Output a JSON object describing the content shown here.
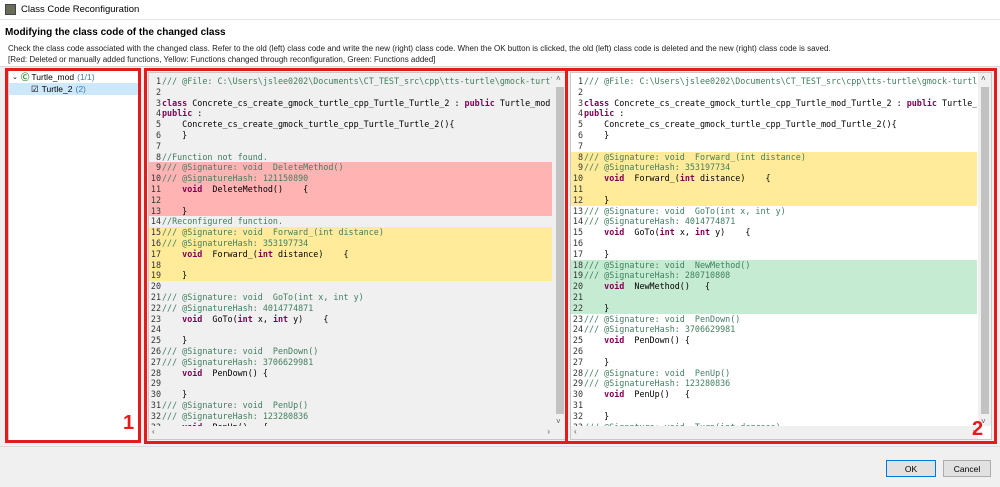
{
  "window": {
    "title": "Class Code Reconfiguration"
  },
  "header": {
    "heading": "Modifying the class code of the changed class",
    "description": "Check the class code associated with the changed class. Refer to the old (left) class code and write the new (right) class code. When the OK button is clicked, the old (left) class code is deleted and the new (right) class code is saved.",
    "legend": "[Red: Deleted or manually added functions, Yellow: Functions changed through reconfiguration, Green: Functions added]"
  },
  "tree": {
    "root": {
      "label": "Turtle_mod",
      "count": "(1/1)"
    },
    "child": {
      "label": "Turtle_2",
      "count": "(2)"
    }
  },
  "annotations": {
    "one": "1",
    "two": "2"
  },
  "colors": {
    "red": "#ffb3b3",
    "yellow": "#ffeb99",
    "green": "#c5ebd2",
    "annotation": "#e51a1a"
  },
  "left_code": [
    {
      "n": "1",
      "t": "/// @File: C:\\Users\\jslee0202\\Documents\\CT_TEST_src\\cpp\\tts-turtle\\gmock-turtl"
    },
    {
      "n": "2",
      "t": ""
    },
    {
      "n": "3",
      "t": "class Concrete_cs_create_gmock_turtle_cpp_Turtle_Turtle_2 : public Turtle_mod"
    },
    {
      "n": "4",
      "t": "public :"
    },
    {
      "n": "5",
      "t": "    Concrete_cs_create_gmock_turtle_cpp_Turtle_Turtle_2(){"
    },
    {
      "n": "6",
      "t": "    }"
    },
    {
      "n": "7",
      "t": ""
    },
    {
      "n": "8",
      "t": "//Function not found."
    },
    {
      "n": "9",
      "t": "/// @Signature: void  DeleteMethod()",
      "bg": "red"
    },
    {
      "n": "10",
      "t": "/// @SignatureHash: 121150890",
      "bg": "red"
    },
    {
      "n": "11",
      "t": "    void  DeleteMethod()    {",
      "bg": "red"
    },
    {
      "n": "12",
      "t": "",
      "bg": "red"
    },
    {
      "n": "13",
      "t": "    }",
      "bg": "red"
    },
    {
      "n": "14",
      "t": "//Reconfigured function."
    },
    {
      "n": "15",
      "t": "/// @Signature: void  Forward_(int distance)",
      "bg": "yellow"
    },
    {
      "n": "16",
      "t": "/// @SignatureHash: 353197734",
      "bg": "yellow"
    },
    {
      "n": "17",
      "t": "    void  Forward_(int distance)    {",
      "bg": "yellow"
    },
    {
      "n": "18",
      "t": "",
      "bg": "yellow"
    },
    {
      "n": "19",
      "t": "    }",
      "bg": "yellow"
    },
    {
      "n": "20",
      "t": ""
    },
    {
      "n": "21",
      "t": "/// @Signature: void  GoTo(int x, int y)"
    },
    {
      "n": "22",
      "t": "/// @SignatureHash: 4014774871"
    },
    {
      "n": "23",
      "t": "    void  GoTo(int x, int y)    {"
    },
    {
      "n": "24",
      "t": ""
    },
    {
      "n": "25",
      "t": "    }"
    },
    {
      "n": "26",
      "t": "/// @Signature: void  PenDown()"
    },
    {
      "n": "27",
      "t": "/// @SignatureHash: 3706629981"
    },
    {
      "n": "28",
      "t": "    void  PenDown() {"
    },
    {
      "n": "29",
      "t": ""
    },
    {
      "n": "30",
      "t": "    }"
    },
    {
      "n": "31",
      "t": "/// @Signature: void  PenUp()"
    },
    {
      "n": "32",
      "t": "/// @SignatureHash: 123280836"
    },
    {
      "n": "33",
      "t": "    void  PenUp()   {"
    }
  ],
  "right_code": [
    {
      "n": "1",
      "t": "/// @File: C:\\Users\\jslee0202\\Documents\\CT_TEST_src\\cpp\\tts-turtle\\gmock-turtl"
    },
    {
      "n": "2",
      "t": ""
    },
    {
      "n": "3",
      "t": "class Concrete_cs_create_gmock_turtle_cpp_Turtle_mod_Turtle_2 : public Turtle_"
    },
    {
      "n": "4",
      "t": "public :"
    },
    {
      "n": "5",
      "t": "    Concrete_cs_create_gmock_turtle_cpp_Turtle_mod_Turtle_2(){"
    },
    {
      "n": "6",
      "t": "    }"
    },
    {
      "n": "7",
      "t": ""
    },
    {
      "n": "8",
      "t": "/// @Signature: void  Forward_(int distance)",
      "bg": "yellow"
    },
    {
      "n": "9",
      "t": "/// @SignatureHash: 353197734",
      "bg": "yellow"
    },
    {
      "n": "10",
      "t": "    void  Forward_(int distance)    {",
      "bg": "yellow"
    },
    {
      "n": "11",
      "t": "",
      "bg": "yellow"
    },
    {
      "n": "12",
      "t": "    }",
      "bg": "yellow"
    },
    {
      "n": "13",
      "t": "/// @Signature: void  GoTo(int x, int y)"
    },
    {
      "n": "14",
      "t": "/// @SignatureHash: 4014774871"
    },
    {
      "n": "15",
      "t": "    void  GoTo(int x, int y)    {"
    },
    {
      "n": "16",
      "t": ""
    },
    {
      "n": "17",
      "t": "    }"
    },
    {
      "n": "18",
      "t": "/// @Signature: void  NewMethod()",
      "bg": "green"
    },
    {
      "n": "19",
      "t": "/// @SignatureHash: 280710808",
      "bg": "green"
    },
    {
      "n": "20",
      "t": "    void  NewMethod()   {",
      "bg": "green"
    },
    {
      "n": "21",
      "t": "",
      "bg": "green"
    },
    {
      "n": "22",
      "t": "    }",
      "bg": "green"
    },
    {
      "n": "23",
      "t": "/// @Signature: void  PenDown()"
    },
    {
      "n": "24",
      "t": "/// @SignatureHash: 3706629981"
    },
    {
      "n": "25",
      "t": "    void  PenDown() {"
    },
    {
      "n": "26",
      "t": ""
    },
    {
      "n": "27",
      "t": "    }"
    },
    {
      "n": "28",
      "t": "/// @Signature: void  PenUp()"
    },
    {
      "n": "29",
      "t": "/// @SignatureHash: 123280836"
    },
    {
      "n": "30",
      "t": "    void  PenUp()   {"
    },
    {
      "n": "31",
      "t": ""
    },
    {
      "n": "32",
      "t": "    }"
    },
    {
      "n": "33",
      "t": "/// @Signature: void  Turn(int degrees)"
    }
  ],
  "buttons": {
    "ok": "OK",
    "cancel": "Cancel"
  }
}
